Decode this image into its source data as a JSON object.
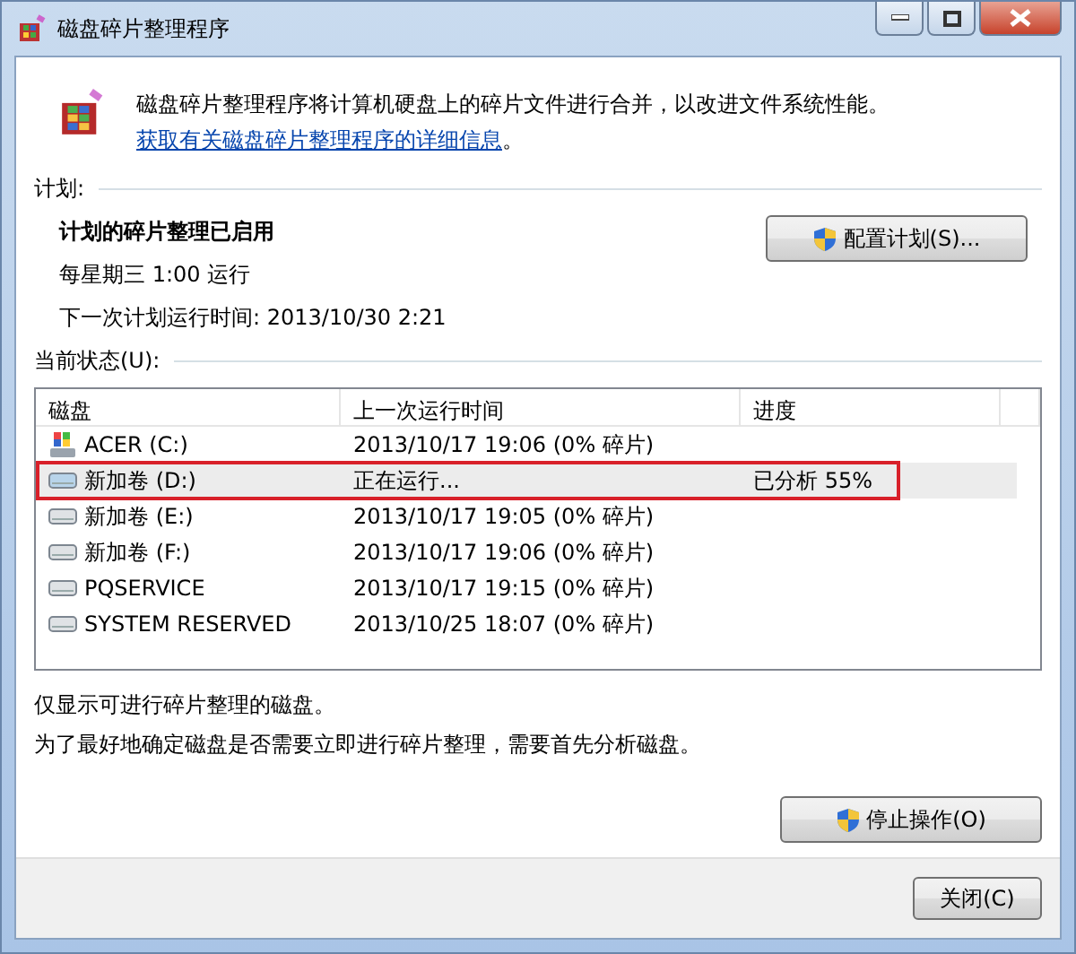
{
  "window": {
    "title": "磁盘碎片整理程序"
  },
  "intro": {
    "text": "磁盘碎片整理程序将计算机硬盘上的碎片文件进行合并，以改进文件系统性能。",
    "link": "获取有关磁盘碎片整理程序的详细信息",
    "tail": "。"
  },
  "schedule": {
    "heading": "计划:",
    "status": "计划的碎片整理已启用",
    "when": "每星期三  1:00 运行",
    "next": "下一次计划运行时间: 2013/10/30 2:21",
    "button": "配置计划(S)..."
  },
  "current": {
    "heading": "当前状态(U):",
    "columns": [
      "磁盘",
      "上一次运行时间",
      "进度"
    ],
    "rows": [
      {
        "kind": "system",
        "disk": "ACER (C:)",
        "last_run": "2013/10/17 19:06 (0% 碎片)",
        "selected": false,
        "outlined": false
      },
      {
        "kind": "drive",
        "disk": "新加卷 (D:)",
        "last_run": "正在运行...",
        "progress": "已分析 55%",
        "selected": true,
        "outlined": true
      },
      {
        "kind": "drive",
        "disk": "新加卷 (E:)",
        "last_run": "2013/10/17 19:05 (0% 碎片)",
        "selected": false,
        "outlined": false
      },
      {
        "kind": "drive",
        "disk": "新加卷 (F:)",
        "last_run": "2013/10/17 19:06 (0% 碎片)",
        "selected": false,
        "outlined": false
      },
      {
        "kind": "drive",
        "disk": "PQSERVICE",
        "last_run": "2013/10/17 19:15 (0% 碎片)",
        "selected": false,
        "outlined": false
      },
      {
        "kind": "drive",
        "disk": "SYSTEM RESERVED",
        "last_run": "2013/10/25 18:07 (0% 碎片)",
        "selected": false,
        "outlined": false
      }
    ]
  },
  "notes": [
    "仅显示可进行碎片整理的磁盘。",
    "为了最好地确定磁盘是否需要立即进行碎片整理，需要首先分析磁盘。"
  ],
  "action_button": "停止操作(O)",
  "close_button": "关闭(C)"
}
